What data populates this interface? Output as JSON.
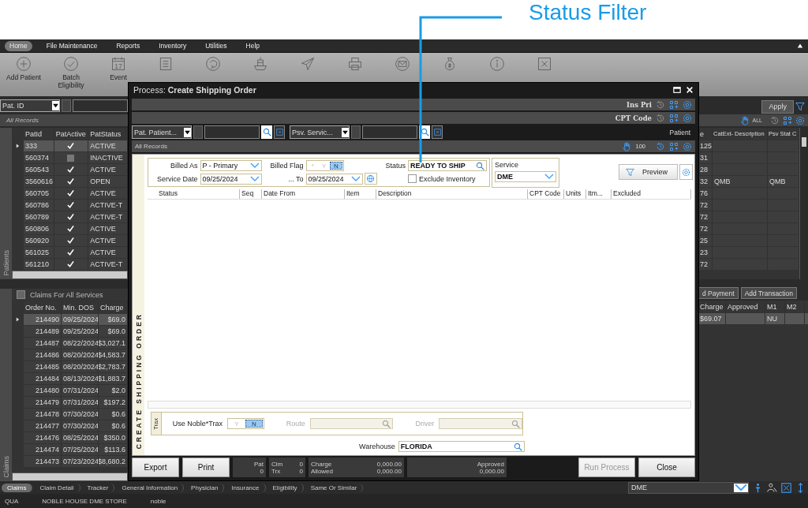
{
  "annotation": {
    "label": "Status Filter"
  },
  "menu": [
    {
      "label": "Home",
      "selected": true
    },
    {
      "label": "File Maintenance",
      "selected": false
    },
    {
      "label": "Reports",
      "selected": false
    },
    {
      "label": "Inventory",
      "selected": false
    },
    {
      "label": "Utilities",
      "selected": false
    },
    {
      "label": "Help",
      "selected": false
    }
  ],
  "ribbon": [
    {
      "kind": "plus",
      "label": "Add Patient"
    },
    {
      "kind": "check",
      "label": "Batch Eligibility"
    },
    {
      "kind": "calendar",
      "label": "Event",
      "badge": "17"
    },
    {
      "kind": "list"
    },
    {
      "kind": "refresh"
    },
    {
      "kind": "ship"
    },
    {
      "kind": "send"
    },
    {
      "kind": "printer"
    },
    {
      "kind": "mail"
    },
    {
      "kind": "money"
    },
    {
      "kind": "info"
    },
    {
      "kind": "exit"
    }
  ],
  "patients": {
    "filter_field": "Pat. ID",
    "view": "All Records",
    "side_label": "Patients",
    "columns": [
      "PatId",
      "PatActive",
      "PatStatus"
    ],
    "rows": [
      {
        "id": "333",
        "active": true,
        "status": "ACTIVE",
        "selected": true
      },
      {
        "id": "560374",
        "active": false,
        "status": "INACTIVE",
        "selected": false
      },
      {
        "id": "560543",
        "active": true,
        "status": "ACTIVE",
        "selected": false
      },
      {
        "id": "3560616",
        "active": true,
        "status": "OPEN",
        "selected": false
      },
      {
        "id": "560705",
        "active": true,
        "status": "ACTIVE",
        "selected": false
      },
      {
        "id": "560786",
        "active": true,
        "status": "ACTIVE-T",
        "selected": false
      },
      {
        "id": "560789",
        "active": true,
        "status": "ACTIVE-T",
        "selected": false
      },
      {
        "id": "560806",
        "active": true,
        "status": "ACTIVE",
        "selected": false
      },
      {
        "id": "560920",
        "active": true,
        "status": "ACTIVE",
        "selected": false
      },
      {
        "id": "561025",
        "active": true,
        "status": "ACTIVE",
        "selected": false
      },
      {
        "id": "561210",
        "active": true,
        "status": "ACTIVE-T",
        "selected": false
      }
    ]
  },
  "patients_right": {
    "apply": "Apply",
    "scope": "ALL",
    "columns": [
      "e",
      "CatExt- Description",
      "Psv Stat C"
    ],
    "rows": [
      {
        "column_1": "125",
        "description": "",
        "psv": ""
      },
      {
        "column_1": "31",
        "description": "",
        "psv": ""
      },
      {
        "column_1": "28",
        "description": "",
        "psv": ""
      },
      {
        "column_1": "32",
        "description": "QMB",
        "psv": "QMB"
      },
      {
        "column_1": "76",
        "description": "",
        "psv": ""
      },
      {
        "column_1": "72",
        "description": "",
        "psv": ""
      },
      {
        "column_1": "72",
        "description": "",
        "psv": ""
      },
      {
        "column_1": "72",
        "description": "",
        "psv": ""
      },
      {
        "column_1": "25",
        "description": "",
        "psv": ""
      },
      {
        "column_1": "23",
        "description": "",
        "psv": ""
      },
      {
        "column_1": "72",
        "description": "",
        "psv": ""
      }
    ]
  },
  "claims": {
    "title": "Claims For All Services",
    "all_checked": false,
    "side_label": "Claims",
    "columns": [
      "Order No.",
      "Min. DOS",
      "Charge"
    ],
    "rows": [
      {
        "order": "214490",
        "dos": "09/25/2024",
        "charge": "$69.0",
        "selected": true
      },
      {
        "order": "214489",
        "dos": "09/25/2024",
        "charge": "$69.0",
        "selected": false
      },
      {
        "order": "214487",
        "dos": "08/22/2024",
        "charge": "$3,027.1",
        "selected": false
      },
      {
        "order": "214486",
        "dos": "08/20/2024",
        "charge": "$4,583.7",
        "selected": false
      },
      {
        "order": "214485",
        "dos": "08/20/2024",
        "charge": "$2,783.7",
        "selected": false
      },
      {
        "order": "214484",
        "dos": "08/13/2024",
        "charge": "$1,883.7",
        "selected": false
      },
      {
        "order": "214480",
        "dos": "07/31/2024",
        "charge": "$2.0",
        "selected": false
      },
      {
        "order": "214479",
        "dos": "07/31/2024",
        "charge": "$197.2",
        "selected": false
      },
      {
        "order": "214478",
        "dos": "07/30/2024",
        "charge": "$0.6",
        "selected": false
      },
      {
        "order": "214477",
        "dos": "07/30/2024",
        "charge": "$0.6",
        "selected": false
      },
      {
        "order": "214476",
        "dos": "08/25/2024",
        "charge": "$350.0",
        "selected": false
      },
      {
        "order": "214474",
        "dos": "07/25/2024",
        "charge": "$113.6",
        "selected": false
      },
      {
        "order": "214473",
        "dos": "07/23/2024",
        "charge": "$8,680.2",
        "selected": false
      }
    ]
  },
  "claims_right": {
    "buttons": [
      "d Payment",
      "Add Transaction"
    ],
    "columns": [
      "Charge",
      "Approved",
      "M1",
      "M2"
    ],
    "rows": [
      {
        "charge": "$69.07",
        "approved": "",
        "m1": "NU",
        "m2": ""
      }
    ]
  },
  "bottom_tabs": [
    {
      "label": "Claims",
      "selected": true
    },
    {
      "label": "Claim Detail",
      "selected": false
    },
    {
      "label": "Tracker",
      "selected": false
    },
    {
      "label": "General Information",
      "selected": false
    },
    {
      "label": "Physician",
      "selected": false
    },
    {
      "label": "Insurance",
      "selected": false
    },
    {
      "label": "Eligibility",
      "selected": false
    },
    {
      "label": "Same Or Similar",
      "selected": false
    }
  ],
  "service_selector": "DME",
  "status_bar": [
    "QUA",
    "NOBLE HOUSE DME STORE",
    "noble"
  ],
  "dialog": {
    "title": "Process: **Create Shipping Order**",
    "setting_rows": [
      "Ins Pri",
      "CPT Code"
    ],
    "filters": [
      "Pat. Patient...",
      "Psv. Servic..."
    ],
    "filter_caption": "Patient",
    "view": "All Records",
    "page_size": "100",
    "side_label": "CREATE SHIPPING ORDER",
    "form": {
      "billed_as": {
        "label": "Billed As",
        "value": "P - Primary"
      },
      "service_date": {
        "label": "Service Date",
        "value": "09/25/2024"
      },
      "billed_flag": {
        "label": "Billed Flag",
        "options": [
          {
            "label": "*",
            "selected": false
          },
          {
            "label": "Y",
            "selected": false
          },
          {
            "label": "N",
            "selected": true
          }
        ]
      },
      "date_to": {
        "label": "... To",
        "value": "09/25/2024"
      },
      "status": {
        "label": "Status",
        "value": "READY TO SHIP"
      },
      "exclude_inventory": {
        "label": "Exclude Inventory",
        "checked": false
      },
      "service": {
        "label": "Service",
        "value": "DME"
      },
      "preview": "Preview"
    },
    "columns": [
      "Status",
      "Seq",
      "Date From",
      "Item",
      "Description",
      "CPT Code",
      "Units",
      "Itm...",
      "Excluded"
    ],
    "trax": {
      "tab": "Trax",
      "label": "Use Noble*Trax",
      "options": [
        {
          "label": "Y",
          "selected": false
        },
        {
          "label": "N",
          "selected": true
        }
      ],
      "route": "Route",
      "driver": "Driver"
    },
    "warehouse": {
      "label": "Warehouse",
      "value": "FLORIDA"
    },
    "buttons_left": [
      {
        "label": "Export",
        "disabled": false
      },
      {
        "label": "Print",
        "disabled": false
      }
    ],
    "stats": [
      {
        "kind": "stacked",
        "items": [
          {
            "label": "Pat",
            "value": "0"
          }
        ]
      },
      {
        "kind": "pairs",
        "items": [
          {
            "label": "Clm",
            "value": "0"
          },
          {
            "label": "Trx",
            "value": "0"
          }
        ]
      },
      {
        "kind": "pairs",
        "items": [
          {
            "label": "Charge",
            "value": "0,000.00"
          },
          {
            "label": "Allowed",
            "value": "0,000.00"
          }
        ]
      },
      {
        "kind": "stacked",
        "items": [
          {
            "label": "Approved",
            "value": "0,000.00"
          }
        ]
      }
    ],
    "buttons_right": [
      {
        "label": "Run Process",
        "disabled": true
      },
      {
        "label": "Close",
        "disabled": false
      }
    ]
  }
}
